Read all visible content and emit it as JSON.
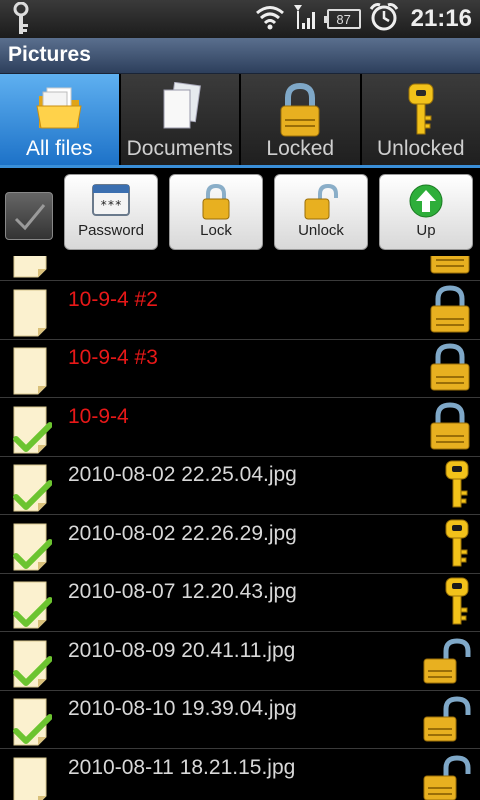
{
  "status_bar": {
    "battery": "87",
    "time": "21:16"
  },
  "title": "Pictures",
  "tabs": [
    {
      "label": "All files",
      "icon": "folder-icon",
      "active": true
    },
    {
      "label": "Documents",
      "icon": "documents-icon",
      "active": false
    },
    {
      "label": "Locked",
      "icon": "lock-icon",
      "active": false
    },
    {
      "label": "Unlocked",
      "icon": "key-icon",
      "active": false
    }
  ],
  "toolbar": {
    "password_label": "Password",
    "lock_label": "Lock",
    "unlock_label": "Unlock",
    "up_label": "Up"
  },
  "files": [
    {
      "name": "",
      "checked": false,
      "status": "locked"
    },
    {
      "name": "10-9-4 #2",
      "checked": false,
      "status": "locked"
    },
    {
      "name": "10-9-4 #3",
      "checked": false,
      "status": "locked"
    },
    {
      "name": "10-9-4",
      "checked": true,
      "status": "locked"
    },
    {
      "name": "2010-08-02 22.25.04.jpg",
      "checked": true,
      "status": "key"
    },
    {
      "name": "2010-08-02 22.26.29.jpg",
      "checked": true,
      "status": "key"
    },
    {
      "name": "2010-08-07 12.20.43.jpg",
      "checked": true,
      "status": "key"
    },
    {
      "name": "2010-08-09 20.41.11.jpg",
      "checked": true,
      "status": "unlocked"
    },
    {
      "name": "2010-08-10 19.39.04.jpg",
      "checked": true,
      "status": "unlocked"
    },
    {
      "name": "2010-08-11 18.21.15.jpg",
      "checked": false,
      "status": "unlocked"
    }
  ]
}
